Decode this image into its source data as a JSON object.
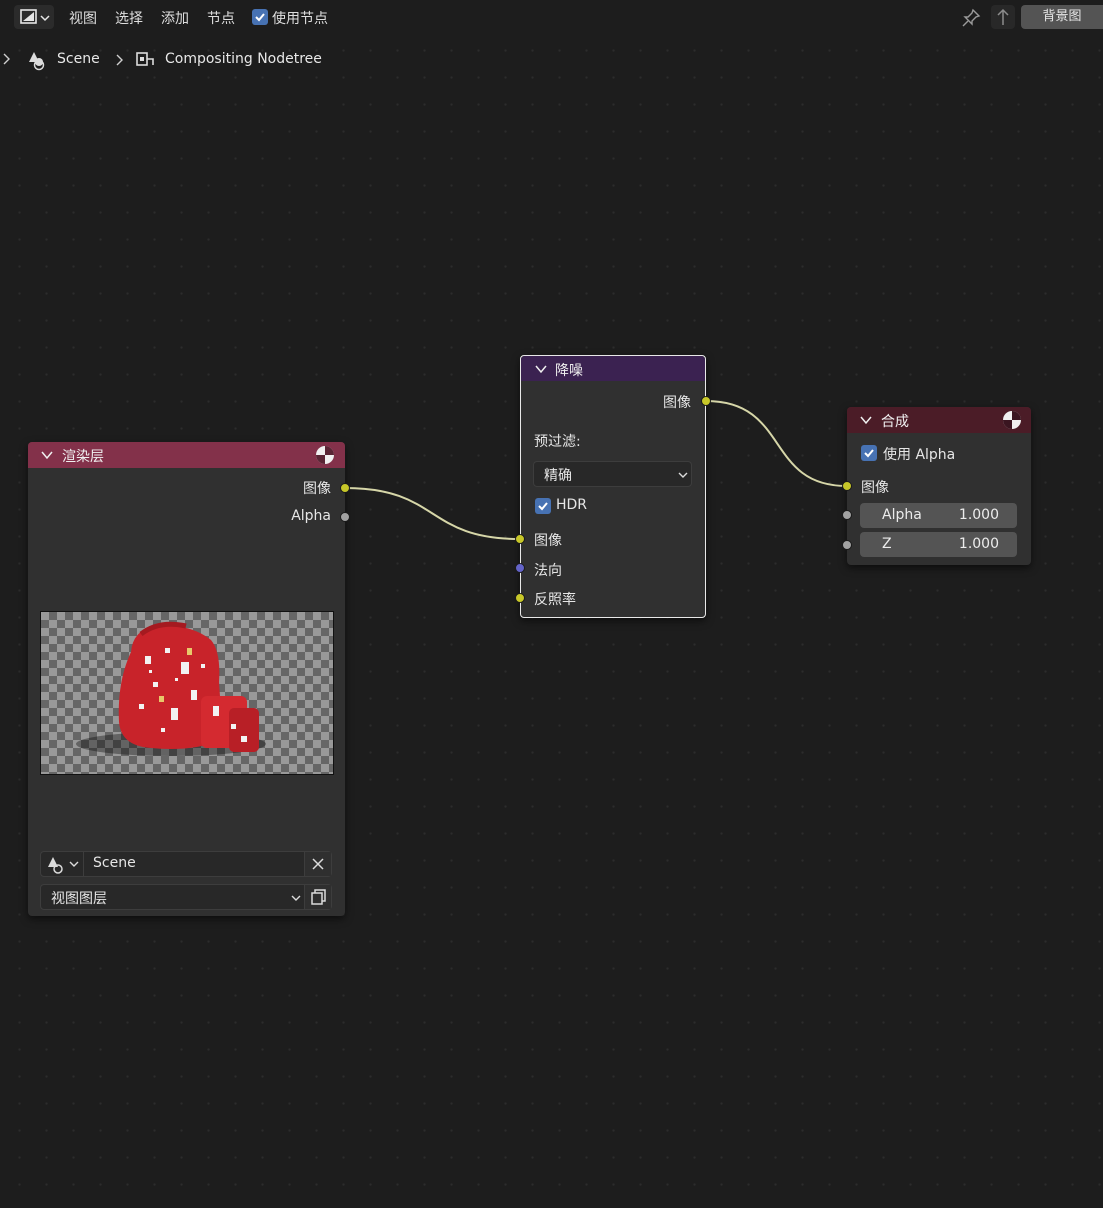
{
  "header": {
    "menus": [
      "视图",
      "选择",
      "添加",
      "节点"
    ],
    "use_nodes_label": "使用节点",
    "use_nodes_checked": true,
    "background_button": "背景图"
  },
  "breadcrumb": {
    "scene": "Scene",
    "nodetree": "Compositing Nodetree"
  },
  "nodes": {
    "render_layers": {
      "title": "渲染层",
      "outputs": [
        "图像",
        "Alpha"
      ],
      "scene_value": "Scene",
      "view_layer": "视图图层",
      "header_color": "#83314a"
    },
    "denoise": {
      "title": "降噪",
      "output": "图像",
      "prefilter_label": "预过滤:",
      "prefilter_value": "精确",
      "hdr_label": "HDR",
      "hdr_checked": true,
      "inputs": [
        "图像",
        "法向",
        "反照率"
      ],
      "header_color": "#3b2251"
    },
    "composite": {
      "title": "合成",
      "use_alpha_label": "使用 Alpha",
      "use_alpha_checked": true,
      "image_input": "图像",
      "fields": [
        {
          "label": "Alpha",
          "value": "1.000"
        },
        {
          "label": "Z",
          "value": "1.000"
        }
      ],
      "header_color": "#4b1c27"
    }
  },
  "colors": {
    "socket_color_image": "#c7c729",
    "socket_grey": "#a1a1a1",
    "socket_vector": "#6363c7",
    "link": "#d6d6a8",
    "checkbox": "#4772b3"
  }
}
